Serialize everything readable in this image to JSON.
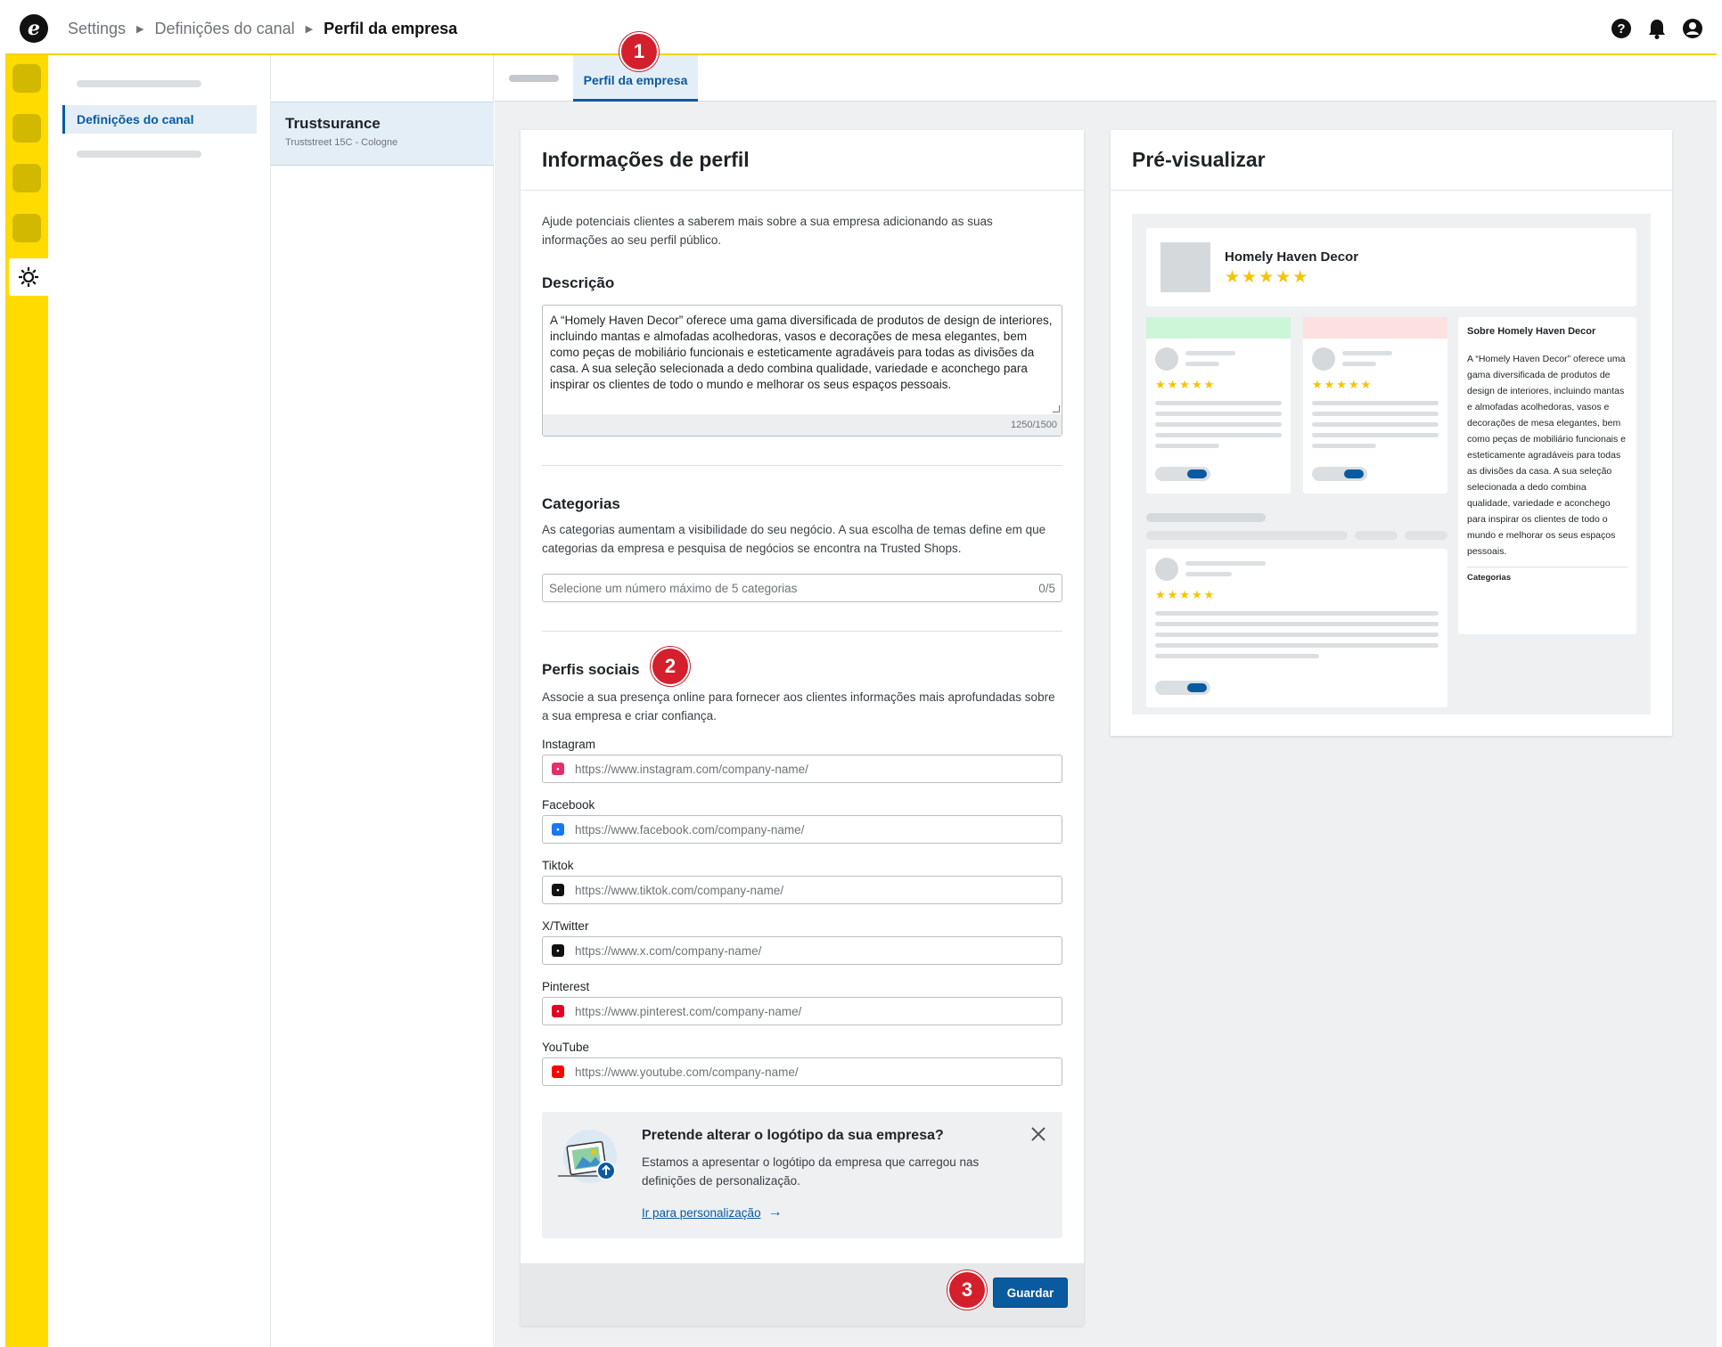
{
  "breadcrumb": {
    "item1": "Settings",
    "item2": "Definições do canal",
    "current": "Perfil da empresa"
  },
  "subnav": {
    "active_item": "Definições do canal"
  },
  "channel": {
    "name": "Trustsurance",
    "address": "Truststreet 15C - Cologne"
  },
  "tabs": {
    "active": "Perfil da empresa"
  },
  "profile": {
    "title": "Informações de perfil",
    "intro": "Ajude potenciais clientes a saberem mais sobre a sua empresa adicionando as suas informações ao seu perfil público.",
    "description": {
      "label": "Descrição",
      "value": "A “Homely Haven Decor” oferece uma gama diversificada de produtos de design de interiores, incluindo mantas e almofadas acolhedoras, vasos e decorações de mesa elegantes, bem como peças de mobiliário funcionais e esteticamente agradáveis para todas as divisões da casa. A sua seleção selecionada a dedo combina qualidade, variedade e aconchego para inspirar os clientes de todo o mundo e melhorar os seus espaços pessoais.",
      "counter": "1250/1500"
    },
    "categories": {
      "label": "Categorias",
      "text": "As categorias aumentam a visibilidade do seu negócio. A sua escolha de temas define em que categorias da empresa e pesquisa de negócios se encontra na Trusted Shops.",
      "placeholder": "Selecione um número máximo de 5 categorias",
      "count": "0/5"
    },
    "social": {
      "label": "Perfis sociais",
      "text": "Associe a sua presença online para fornecer aos clientes informações mais aprofundadas sobre a sua empresa e criar confiança.",
      "fields": [
        {
          "label": "Instagram",
          "placeholder": "https://www.instagram.com/company-name/",
          "color": "#e1306c",
          "icon": "instagram-icon"
        },
        {
          "label": "Facebook",
          "placeholder": "https://www.facebook.com/company-name/",
          "color": "#1877f2",
          "icon": "facebook-icon"
        },
        {
          "label": "Tiktok",
          "placeholder": "https://www.tiktok.com/company-name/",
          "color": "#111111",
          "icon": "tiktok-icon"
        },
        {
          "label": "X/Twitter",
          "placeholder": "https://www.x.com/company-name/",
          "color": "#111111",
          "icon": "x-icon"
        },
        {
          "label": "Pinterest",
          "placeholder": "https://www.pinterest.com/company-name/",
          "color": "#e60023",
          "icon": "pinterest-icon"
        },
        {
          "label": "YouTube",
          "placeholder": "https://www.youtube.com/company-name/",
          "color": "#ff0000",
          "icon": "youtube-icon"
        }
      ]
    },
    "logo_banner": {
      "title": "Pretende alterar o logótipo da sua empresa?",
      "text": "Estamos a apresentar o logótipo da empresa que carregou nas definições de personalização.",
      "link": "Ir para personalização"
    },
    "save_label": "Guardar"
  },
  "preview": {
    "title": "Pré-visualizar",
    "company": "Homely Haven Decor",
    "stars": "★★★★★",
    "about_title": "Sobre Homely Haven Decor",
    "about_text": "A “Homely Haven Decor” oferece uma gama diversificada de produtos de design de interiores, incluindo mantas e almofadas acolhedoras, vasos e decorações de mesa elegantes, bem como peças de mobiliário funcionais e esteticamente agradáveis para todas as divisões da casa. A sua seleção selecionada a dedo combina qualidade, variedade e aconchego para inspirar os clientes de todo o mundo e melhorar os seus espaços pessoais.",
    "categories_label": "Categorias"
  },
  "markers": {
    "m1": "1",
    "m2": "2",
    "m3": "3"
  },
  "colors": {
    "accent": "#0a5aa0",
    "rail": "#ffdb00",
    "marker": "#d4202c",
    "star": "#f5c400"
  }
}
